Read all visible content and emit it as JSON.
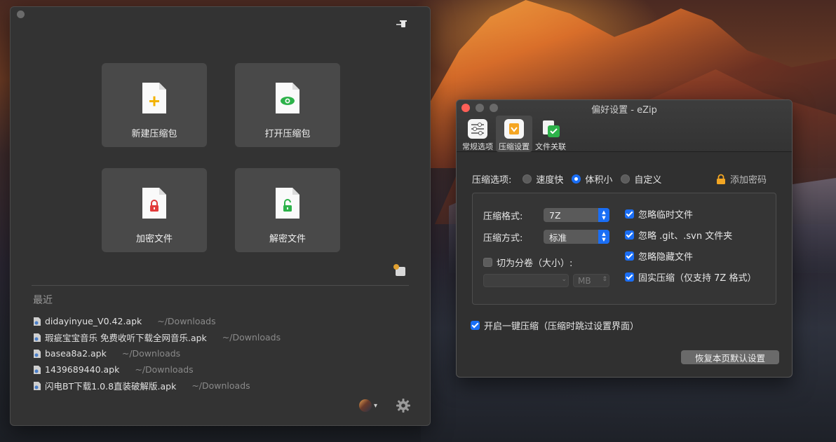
{
  "main_window": {
    "tiles": [
      {
        "label": "新建压缩包",
        "icon": "plus-doc-icon"
      },
      {
        "label": "打开压缩包",
        "icon": "eye-doc-icon"
      },
      {
        "label": "加密文件",
        "icon": "lock-doc-icon"
      },
      {
        "label": "解密文件",
        "icon": "unlock-doc-icon"
      }
    ],
    "recent_title": "最近",
    "recent": [
      {
        "name": "didayinyue_V0.42.apk",
        "path": "~/Downloads"
      },
      {
        "name": "瑕疵宝宝音乐 免费收听下载全网音乐.apk",
        "path": "~/Downloads"
      },
      {
        "name": "basea8a2.apk",
        "path": "~/Downloads"
      },
      {
        "name": "1439689440.apk",
        "path": "~/Downloads"
      },
      {
        "name": "闪电BT下载1.0.8直装破解版.apk",
        "path": "~/Downloads"
      }
    ]
  },
  "prefs": {
    "title": "偏好设置 - eZip",
    "tabs": [
      {
        "label": "常规选项",
        "icon": "sliders-icon"
      },
      {
        "label": "压缩设置",
        "icon": "compress-icon"
      },
      {
        "label": "文件关联",
        "icon": "file-check-icon"
      }
    ],
    "compress_option_label": "压缩选项:",
    "radio_fast": "速度快",
    "radio_small": "体积小",
    "radio_custom": "自定义",
    "selected_option": "体积小",
    "add_password": "添加密码",
    "format_label": "压缩格式:",
    "format_value": "7Z",
    "method_label": "压缩方式:",
    "method_value": "标准",
    "split_label": "切为分卷（大小）:",
    "split_unit": "MB",
    "ignore_temp": "忽略临时文件",
    "ignore_git": "忽略 .git、.svn 文件夹",
    "ignore_hidden": "忽略隐藏文件",
    "solid": "固实压缩（仅支持 7Z 格式）",
    "one_click": "开启一键压缩（压缩时跳过设置界面）",
    "restore_btn": "恢复本页默认设置"
  },
  "colors": {
    "accent": "#1a6ef5",
    "window_bg": "#333333",
    "tile_bg": "#494949"
  }
}
